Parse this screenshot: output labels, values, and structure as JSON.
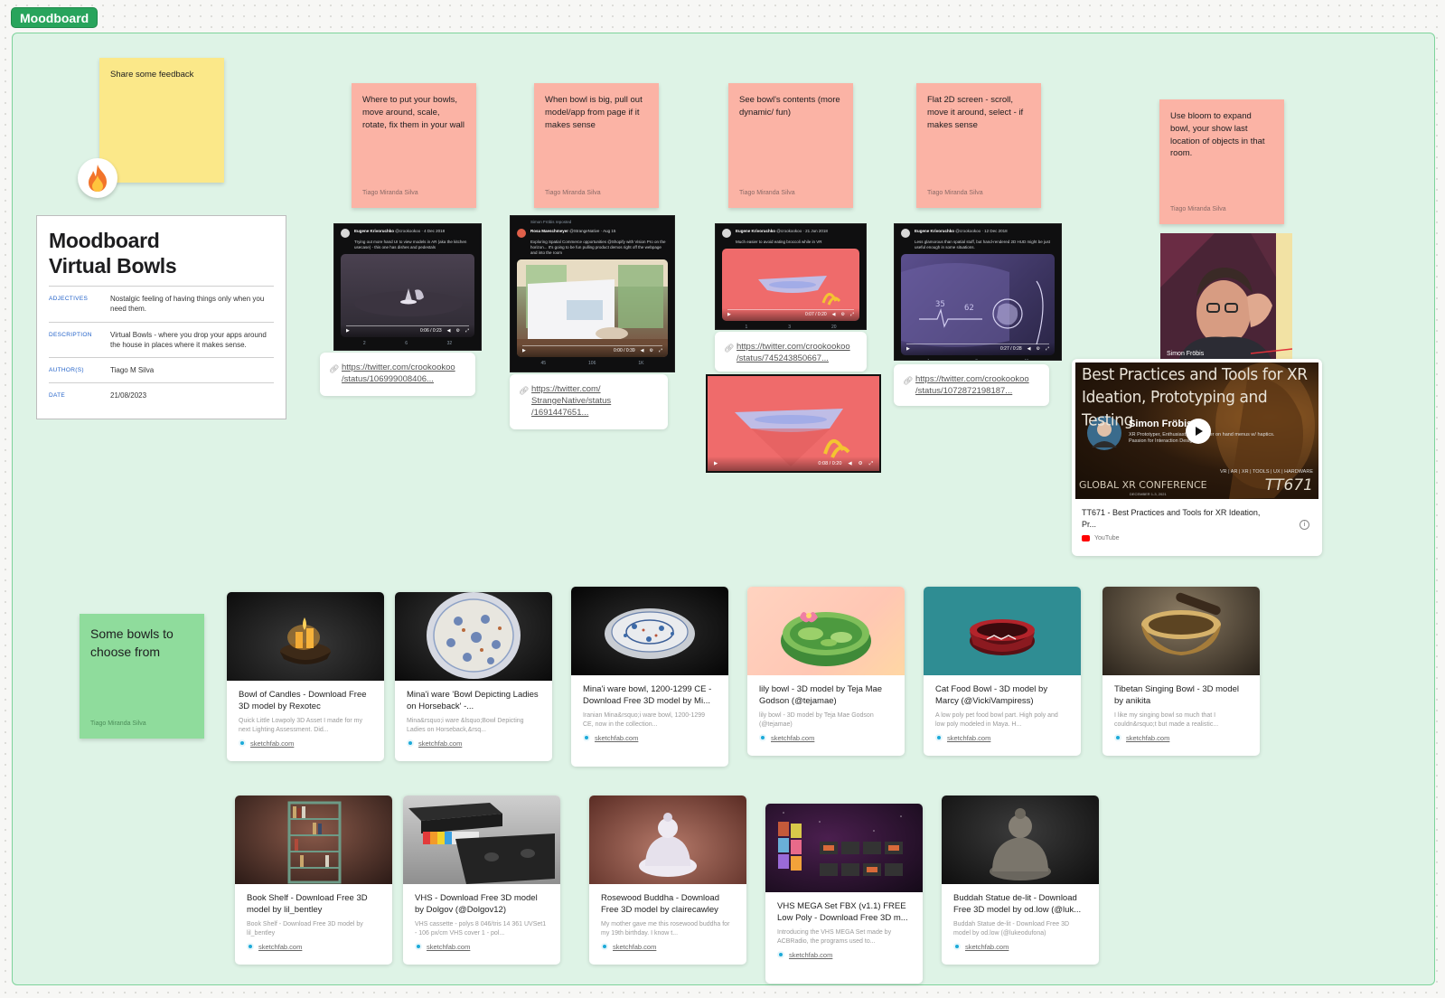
{
  "board": {
    "frame_label": "Moodboard",
    "accent": "#28a45c",
    "frame_bg": "#def3e6"
  },
  "stickies": {
    "feedback": "Share some feedback",
    "n1": "Where to put your bowls, move around, scale, rotate, fix them in your wall",
    "n2": "When bowl is big, pull out model/app from page if it makes sense",
    "n3": "See bowl's contents (more dynamic/ fun)",
    "n4": "Flat 2D screen - scroll, move it around, select - if makes sense",
    "n5": "Use bloom to expand bowl, your show last location of objects in that room.",
    "bowls": "Some bowls to choose from",
    "author": "Tiago Miranda Silva"
  },
  "fire_icon": "fire-emoji-reaction",
  "info": {
    "title_line1": "Moodboard",
    "title_line2": "Virtual Bowls",
    "rows": [
      {
        "key": "ADJECTIVES",
        "value": "Nostalgic feeling of having things only when you need them."
      },
      {
        "key": "DESCRIPTION",
        "value": "Virtual Bowls - where you drop your apps around the house in places where it makes sense."
      },
      {
        "key": "AUTHOR(S)",
        "value": "Tiago M Silva"
      },
      {
        "key": "DATE",
        "value": "21/08/2023"
      }
    ]
  },
  "tweets": [
    {
      "name": "Eugene Krivoruchko",
      "handle": "@crookookoo · 4 Dec 2018",
      "text": "Trying out more hand UI to view models in AR (aka the kitchen usecase) - this one has dishes and pedestals",
      "time": "0:06 / 0:23",
      "stats": [
        "2",
        "6",
        "32"
      ]
    },
    {
      "name": "Rosa Maeschmeyer",
      "handle": "@StrangeNative · Aug 15",
      "repost": "Simon Fröbis reposted",
      "text": "Exploring Spatial Commerce opportunities @Shopify with Vision Pro on the horizon... It's going to be fun pulling product demos right off the webpage and into the room",
      "time": "0:00 / 0:39",
      "stats": [
        "45",
        "106",
        "1K"
      ]
    },
    {
      "name": "Eugene Krivoruchko",
      "handle": "@crookookoo · 21 Jun 2018",
      "text": "Much easier to avoid eating broccoli while in VR",
      "time": "0:07 / 0:20",
      "stats": [
        "1",
        "3",
        "20"
      ]
    },
    {
      "name": "Eugene Krivoruchko",
      "handle": "@crookookoo · 12 Dec 2018",
      "text": "Less glamorous than spatial stuff, but hand-rendered 2D HUD might be just useful enough in some situations.",
      "time": "0:27 / 0:28",
      "stats": [
        "4",
        "9",
        "41"
      ]
    }
  ],
  "video_extra_time": "0:08 / 0:20",
  "links": {
    "l1a": "https://twitter.com/crookookoo",
    "l1b": "/status/106999008406...",
    "l2a": "https://twitter.com/",
    "l2b": "StrangeNative/status",
    "l2c": "/1691447651...",
    "l3a": "https://twitter.com/crookookoo",
    "l3b": "/status/745243850667...",
    "l4a": "https://twitter.com/crookookoo",
    "l4b": "/status/1072872198187..."
  },
  "webcam": {
    "name": "Simon Fröbis"
  },
  "youtube": {
    "thumb_title": "Best Practices and Tools for XR Ideation, Prototyping and Testing",
    "speaker": "Simon Fröbis",
    "speaker_bio": "XR Prototyper, Enthusiast, Researcher on hand menus w/ haptics. Passion for Interaction Design",
    "tags": "VR | AR | XR | TOOLS | UX | HARDWARE",
    "conference": "GLOBAL XR CONFERENCE",
    "conf_date": "DECEMBER 1-3, 2021",
    "code": "TT671",
    "title_line1": "TT671 - Best Practices and Tools for XR Ideation,",
    "title_line2": "Pr...",
    "source": "YouTube"
  },
  "cards": [
    {
      "title": "Bowl of Candles - Download Free 3D model by Rexotec",
      "desc": "Quick Little Lowpoly 3D Asset I made for my next Lighting Assessment. Did...",
      "src": "sketchfab.com"
    },
    {
      "title": "Mina'i ware 'Bowl Depicting Ladies on Horseback' -...",
      "desc": "Mina&rsquo;i ware &lsquo;Bowl Depicting Ladies on Horseback,&rsq...",
      "src": "sketchfab.com"
    },
    {
      "title": "Mina'i ware bowl, 1200-1299 CE - Download Free 3D model by Mi...",
      "desc": "Iranian Mina&rsquo;i ware bowl, 1200-1299 CE, now in the collection...",
      "src": "sketchfab.com"
    },
    {
      "title": "lily bowl - 3D model by Teja Mae Godson (@tejamae)",
      "desc": "lily bowl - 3D model by Teja Mae Godson (@tejamae)",
      "src": "sketchfab.com"
    },
    {
      "title": "Cat Food Bowl - 3D model by Marcy (@VickiVampiress)",
      "desc": "A low poly pet food bowl part. High poly and low poly modeled in Maya. H...",
      "src": "sketchfab.com"
    },
    {
      "title": "Tibetan Singing Bowl - 3D model by anikita",
      "desc": "I like my singing bowl so much that I couldn&rsquo;t but made a realistic...",
      "src": "sketchfab.com"
    },
    {
      "title": "Book Shelf - Download Free 3D model by lil_bentley",
      "desc": "Book Shelf - Download Free 3D model by lil_bentley",
      "src": "sketchfab.com"
    },
    {
      "title": "VHS - Download Free 3D model by Dolgov (@Dolgov12)",
      "desc": "VHS cassette - polys 8 046/tris 14 361 UVSet1 - 106 px/cm VHS cover 1 - pol...",
      "src": "sketchfab.com"
    },
    {
      "title": "Rosewood Buddha - Download Free 3D model by clairecawley",
      "desc": "My mother gave me this rosewood buddha for my 19th birthday. I know t...",
      "src": "sketchfab.com"
    },
    {
      "title": "VHS MEGA Set FBX (v1.1) FREE Low Poly - Download Free 3D m...",
      "desc": "Introducing the VHS MEGA Set made by ACBRadio, the programs used to...",
      "src": "sketchfab.com"
    },
    {
      "title": "Buddah Statue de-lit - Download Free 3D model by od.low (@luk...",
      "desc": "Buddah Statue de-lit - Download Free 3D model by od.low (@lukeodufona)",
      "src": "sketchfab.com"
    }
  ]
}
